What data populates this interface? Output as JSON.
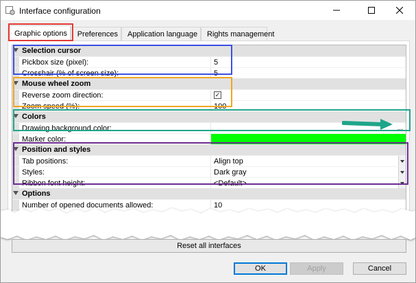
{
  "window": {
    "title": "Interface configuration"
  },
  "tabs": [
    {
      "label": "Graphic options",
      "active": true,
      "icon": "monitor-icon"
    },
    {
      "label": "Preferences",
      "active": false,
      "icon": "gears-icon"
    },
    {
      "label": "Application language",
      "active": false,
      "icon": "language-icon"
    },
    {
      "label": "Rights management",
      "active": false,
      "icon": "lock-icon"
    }
  ],
  "grid": {
    "selection_cursor": {
      "title": "Selection cursor",
      "pickbox_label": "Pickbox size (pixel):",
      "pickbox_value": "5",
      "crosshair_label": "Crosshair (% of screen size):",
      "crosshair_value": "5"
    },
    "mouse_wheel": {
      "title": "Mouse wheel zoom",
      "reverse_label": "Reverse zoom direction:",
      "reverse_checked": true,
      "check_glyph": "✓",
      "speed_label": "Zoom speed (%):",
      "speed_value": "100"
    },
    "colors": {
      "title": "Colors",
      "background_label": "Drawing background color:",
      "background_button": "...",
      "marker_label": "Marker color:",
      "marker_color": "#00ff00"
    },
    "position_styles": {
      "title": "Position and styles",
      "tab_positions_label": "Tab positions:",
      "tab_positions_value": "Align top",
      "styles_label": "Styles:",
      "styles_value": "Dark gray",
      "ribbon_label": "Ribbon font height:",
      "ribbon_value": "<Default>"
    },
    "options": {
      "title": "Options",
      "opened_docs_label": "Number of opened documents allowed:",
      "opened_docs_value": "10"
    }
  },
  "buttons": {
    "reset": "Reset all interfaces",
    "ok": "OK",
    "apply": "Apply",
    "cancel": "Cancel"
  },
  "colors": {
    "highlight_red": "#e53935",
    "highlight_blue": "#3c4fe0",
    "highlight_orange": "#f0a622",
    "highlight_green": "#1fa58a",
    "highlight_purple": "#6a2c91",
    "arrow_teal": "#1fa58a"
  }
}
